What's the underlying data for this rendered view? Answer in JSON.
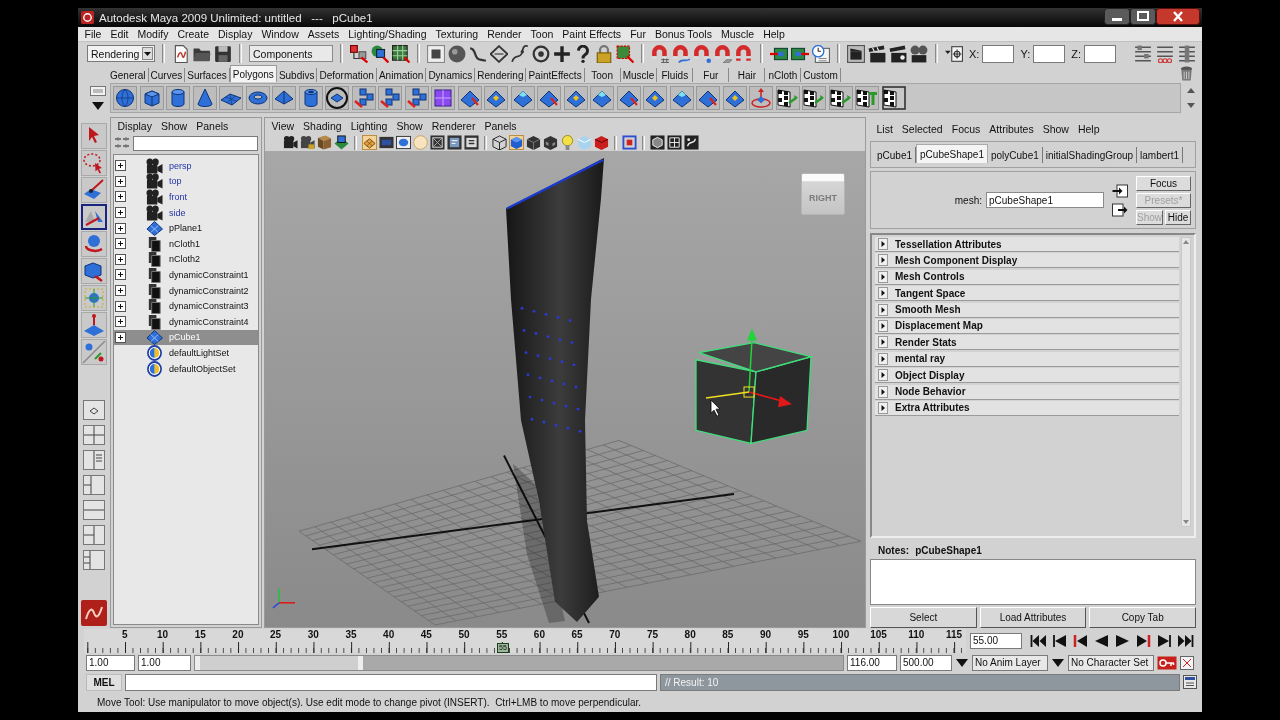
{
  "window": {
    "title": "Autodesk Maya 2009 Unlimited: untitled   ---   pCube1"
  },
  "menu_bar": [
    "File",
    "Edit",
    "Modify",
    "Create",
    "Display",
    "Window",
    "Assets",
    "Lighting/Shading",
    "Texturing",
    "Render",
    "Toon",
    "Paint Effects",
    "Fur",
    "Bonus Tools",
    "Muscle",
    "Help"
  ],
  "status_line": {
    "menu_set": "Rendering",
    "selection_mask": "Components",
    "coordinates": [
      {
        "label": "X:"
      },
      {
        "label": "Y:"
      },
      {
        "label": "Z:"
      }
    ]
  },
  "shelf": {
    "tabs": [
      {
        "label": "General",
        "selected": false
      },
      {
        "label": "Curves",
        "selected": false
      },
      {
        "label": "Surfaces",
        "selected": false
      },
      {
        "label": "Polygons",
        "selected": true
      },
      {
        "label": "Subdivs",
        "selected": false
      },
      {
        "label": "Deformation",
        "selected": false
      },
      {
        "label": "Animation",
        "selected": false
      },
      {
        "label": "Dynamics",
        "selected": false
      },
      {
        "label": "Rendering",
        "selected": false
      },
      {
        "label": "PaintEffects",
        "selected": false
      },
      {
        "label": "Toon",
        "selected": false
      },
      {
        "label": "Muscle",
        "selected": false
      },
      {
        "label": "Fluids",
        "selected": false
      },
      {
        "label": "Fur",
        "selected": false
      },
      {
        "label": "Hair",
        "selected": false
      },
      {
        "label": "nCloth",
        "selected": false
      },
      {
        "label": "Custom",
        "selected": false
      }
    ]
  },
  "toolbox": {
    "tools": [
      {
        "selected": false
      },
      {
        "selected": false
      },
      {
        "selected": false
      },
      {
        "selected": true
      },
      {
        "selected": false
      },
      {
        "selected": false
      },
      {
        "selected": false
      },
      {
        "selected": false
      },
      {
        "selected": false
      }
    ]
  },
  "outliner": {
    "menu": [
      "Display",
      "Show",
      "Panels"
    ],
    "items": [
      {
        "label": "persp",
        "kind": "camera",
        "expanded": false,
        "selected": false
      },
      {
        "label": "top",
        "kind": "camera",
        "expanded": false,
        "selected": false
      },
      {
        "label": "front",
        "kind": "camera",
        "expanded": false,
        "selected": false
      },
      {
        "label": "side",
        "kind": "camera",
        "expanded": false,
        "selected": false
      },
      {
        "label": "pPlane1",
        "kind": "mesh",
        "expanded": false,
        "selected": false
      },
      {
        "label": "nCloth1",
        "kind": "node",
        "expanded": false,
        "selected": false
      },
      {
        "label": "nCloth2",
        "kind": "node",
        "expanded": false,
        "selected": false
      },
      {
        "label": "dynamicConstraint1",
        "kind": "node",
        "expanded": false,
        "selected": false
      },
      {
        "label": "dynamicConstraint2",
        "kind": "node",
        "expanded": false,
        "selected": false
      },
      {
        "label": "dynamicConstraint3",
        "kind": "node",
        "expanded": false,
        "selected": false
      },
      {
        "label": "dynamicConstraint4",
        "kind": "node",
        "expanded": false,
        "selected": false
      },
      {
        "label": "pCube1",
        "kind": "mesh",
        "expanded": false,
        "selected": true
      },
      {
        "label": "defaultLightSet",
        "kind": "set",
        "selected": false
      },
      {
        "label": "defaultObjectSet",
        "kind": "set",
        "selected": false
      }
    ]
  },
  "viewport": {
    "menu": [
      "View",
      "Shading",
      "Lighting",
      "Show",
      "Renderer",
      "Panels"
    ],
    "view_cube": "RIGHT"
  },
  "attribute_editor": {
    "menu": [
      "List",
      "Selected",
      "Focus",
      "Attributes",
      "Show",
      "Help"
    ],
    "tabs": [
      {
        "label": "pCube1",
        "selected": false
      },
      {
        "label": "pCubeShape1",
        "selected": true
      },
      {
        "label": "polyCube1",
        "selected": false
      },
      {
        "label": "initialShadingGroup",
        "selected": false
      },
      {
        "label": "lambert1",
        "selected": false
      }
    ],
    "node_field": {
      "label": "mesh:",
      "value": "pCubeShape1"
    },
    "buttons": [
      {
        "label": "Focus",
        "disabled": false
      },
      {
        "label": "Presets*",
        "disabled": true
      },
      {
        "label": "Show",
        "disabled": true
      },
      {
        "label": "Hide",
        "disabled": false
      }
    ],
    "sections": [
      {
        "label": "Tessellation Attributes",
        "expanded": false
      },
      {
        "label": "Mesh Component Display",
        "expanded": false
      },
      {
        "label": "Mesh Controls",
        "expanded": false
      },
      {
        "label": "Tangent Space",
        "expanded": false
      },
      {
        "label": "Smooth Mesh",
        "expanded": false
      },
      {
        "label": "Displacement Map",
        "expanded": false
      },
      {
        "label": "Render Stats",
        "expanded": false
      },
      {
        "label": "mental ray",
        "expanded": false
      },
      {
        "label": "Object Display",
        "expanded": false
      },
      {
        "label": "Node Behavior",
        "expanded": false
      },
      {
        "label": "Extra Attributes",
        "expanded": false
      }
    ],
    "notes_label": "Notes:",
    "notes_node": "pCubeShape1",
    "actions": [
      "Select",
      "Load Attributes",
      "Copy Tab"
    ]
  },
  "time_slider": {
    "ticks": [
      "5",
      "10",
      "15",
      "20",
      "25",
      "30",
      "35",
      "40",
      "45",
      "50",
      "55",
      "60",
      "65",
      "70",
      "75",
      "80",
      "85",
      "90",
      "95",
      "100",
      "105",
      "110",
      "115"
    ],
    "current_frame": "55",
    "level": 0.475,
    "current_time": "55.00"
  },
  "range_slider": {
    "start_time": "1.00",
    "playback_start": "1.00",
    "level": 0.26,
    "playback_end": "116.00",
    "end_time": "500.00",
    "anim_layer": "No Anim Layer",
    "character_set": "No Character Set"
  },
  "command_line": {
    "language": "MEL",
    "result": "// Result: 10"
  },
  "help_line": "Move Tool: Use manipulator to move object(s). Use edit mode to change pivot (INSERT).  Ctrl+LMB to move perpendicular."
}
